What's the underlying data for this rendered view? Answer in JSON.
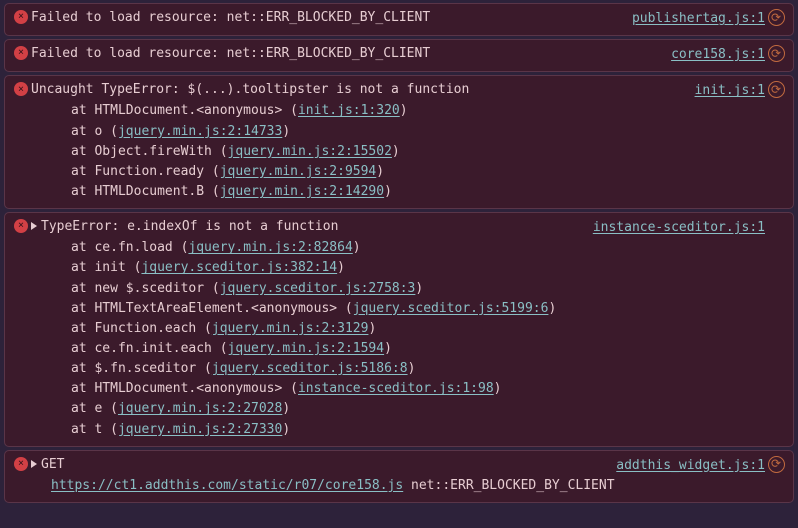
{
  "entries": [
    {
      "message": "Failed to load resource: net::ERR_BLOCKED_BY_CLIENT",
      "source_link": "publishertag.js:1",
      "has_nav": true,
      "expandable": false
    },
    {
      "message": "Failed to load resource: net::ERR_BLOCKED_BY_CLIENT",
      "source_link": "core158.js:1",
      "has_nav": true,
      "expandable": false
    },
    {
      "message": "Uncaught TypeError: $(...).tooltipster is not a function",
      "source_link": "init.js:1",
      "has_nav": true,
      "expandable": false,
      "trace": [
        {
          "pre": "at HTMLDocument.<anonymous> (",
          "link": "init.js:1:320",
          "post": ")"
        },
        {
          "pre": "at o (",
          "link": "jquery.min.js:2:14733",
          "post": ")"
        },
        {
          "pre": "at Object.fireWith (",
          "link": "jquery.min.js:2:15502",
          "post": ")"
        },
        {
          "pre": "at Function.ready (",
          "link": "jquery.min.js:2:9594",
          "post": ")"
        },
        {
          "pre": "at HTMLDocument.B (",
          "link": "jquery.min.js:2:14290",
          "post": ")"
        }
      ]
    },
    {
      "message": "TypeError: e.indexOf is not a function",
      "source_link": "instance-sceditor.js:1",
      "has_nav": false,
      "expandable": true,
      "trace": [
        {
          "pre": "at ce.fn.load (",
          "link": "jquery.min.js:2:82864",
          "post": ")"
        },
        {
          "pre": "at init (",
          "link": "jquery.sceditor.js:382:14",
          "post": ")"
        },
        {
          "pre": "at new $.sceditor (",
          "link": "jquery.sceditor.js:2758:3",
          "post": ")"
        },
        {
          "pre": "at HTMLTextAreaElement.<anonymous> (",
          "link": "jquery.sceditor.js:5199:6",
          "post": ")"
        },
        {
          "pre": "at Function.each (",
          "link": "jquery.min.js:2:3129",
          "post": ")"
        },
        {
          "pre": "at ce.fn.init.each (",
          "link": "jquery.min.js:2:1594",
          "post": ")"
        },
        {
          "pre": "at $.fn.sceditor (",
          "link": "jquery.sceditor.js:5186:8",
          "post": ")"
        },
        {
          "pre": "at HTMLDocument.<anonymous> (",
          "link": "instance-sceditor.js:1:98",
          "post": ")"
        },
        {
          "pre": "at e (",
          "link": "jquery.min.js:2:27028",
          "post": ")"
        },
        {
          "pre": "at t (",
          "link": "jquery.min.js:2:27330",
          "post": ")"
        }
      ]
    },
    {
      "message": "GET",
      "source_link": "addthis_widget.js:1",
      "has_nav": true,
      "expandable": true,
      "extra_line": {
        "link": "https://ct1.addthis.com/static/r07/core158.js",
        "text": " net::ERR_BLOCKED_BY_CLIENT"
      }
    }
  ]
}
